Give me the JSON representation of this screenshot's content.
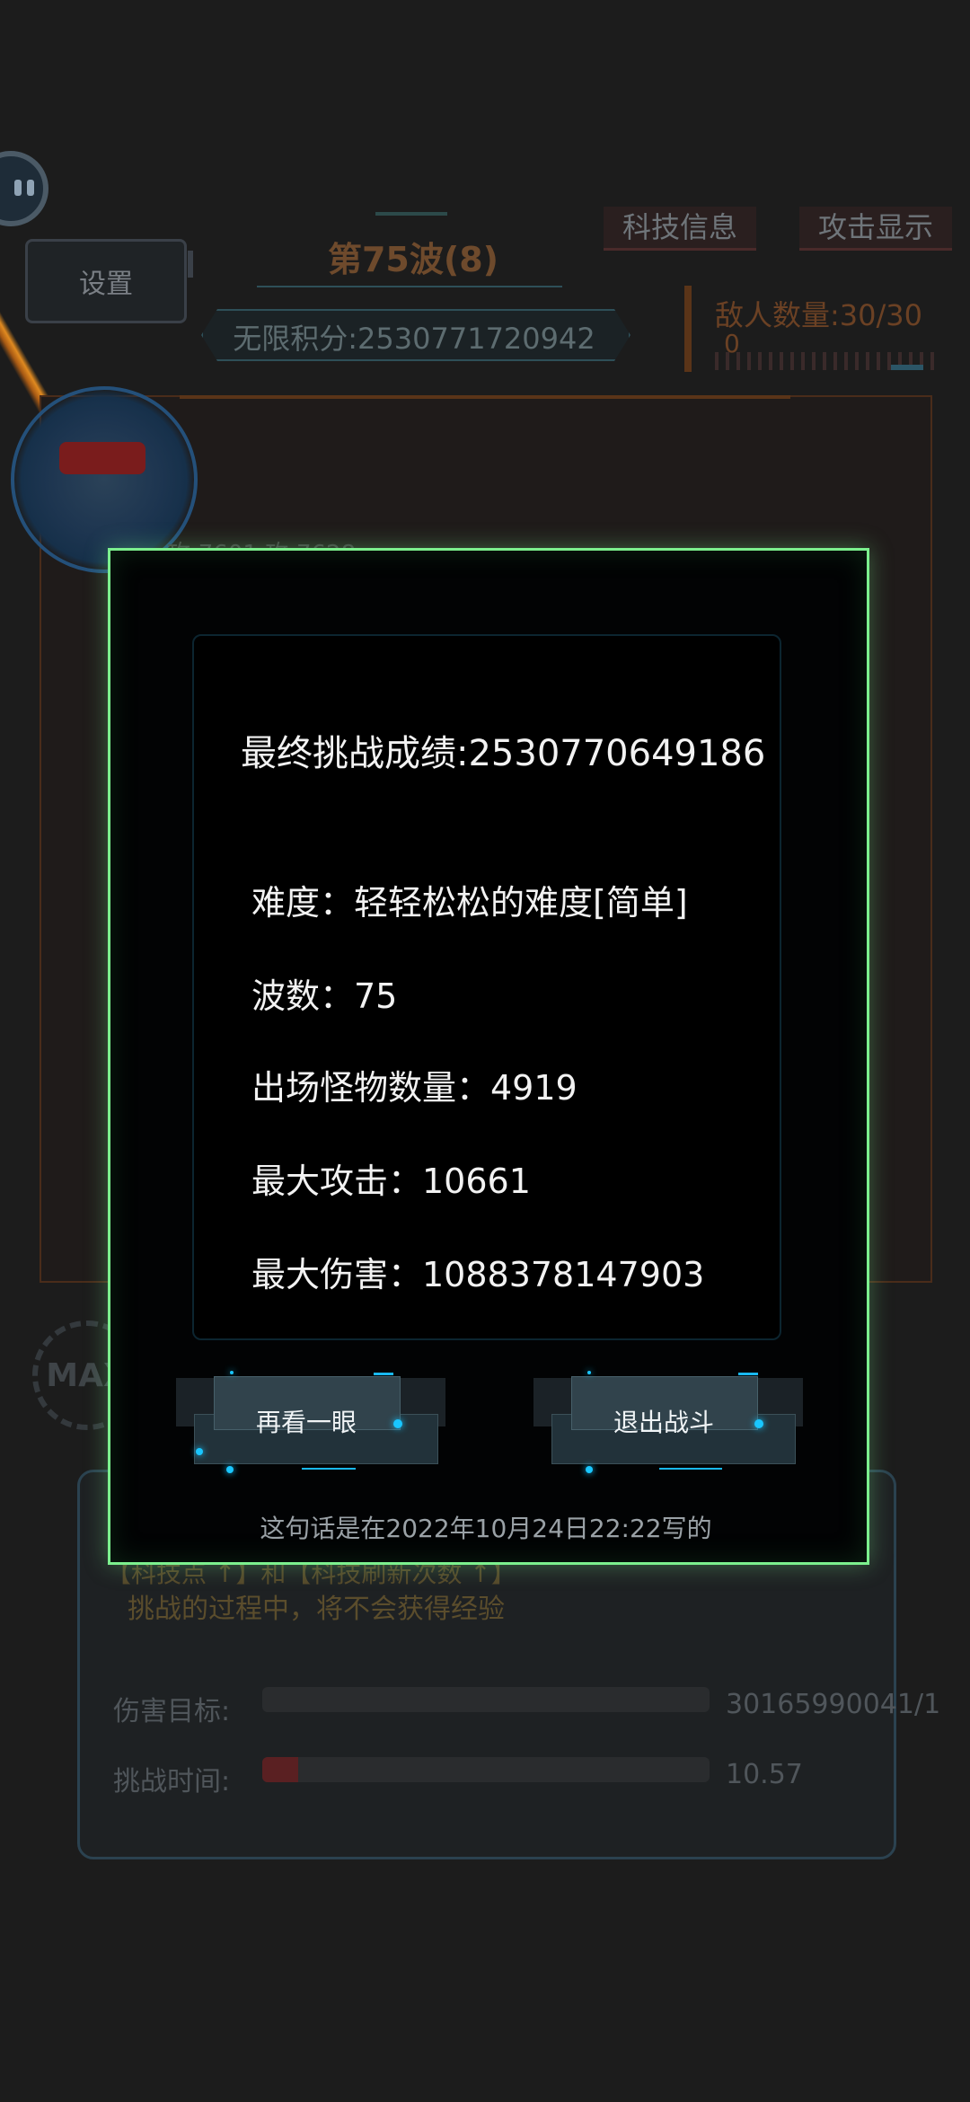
{
  "hud": {
    "settings_label": "设置",
    "wave_title": "第75波(8)",
    "infinite_score": "无限积分:2530771720942",
    "tabs": [
      "科技信息",
      "攻击显示"
    ],
    "enemy_count": "敌人数量:30/30",
    "enemy_count_sub": "0",
    "attack_hint": "攻:7601      攻:7628",
    "max_badge": "MAX",
    "enemy_color": "#6b4124",
    "accent_color": "#7cf08e"
  },
  "info_panel": {
    "line1": "【科技点  ↑】和【科技刷新次数  ↑】",
    "line2": "挑战的过程中，将不会获得经验",
    "damage_target_label": "伤害目标:",
    "damage_target_value": "30165990041/1",
    "damage_target_progress": 0,
    "challenge_time_label": "挑战时间:",
    "challenge_time_value": "10.57",
    "challenge_time_progress": 0.08
  },
  "result": {
    "final_score": "最终挑战成绩:2530770649186",
    "difficulty": "难度：轻轻松松的难度[简单]",
    "waves": "波数：75",
    "monster_count": "出场怪物数量：4919",
    "max_attack": "最大攻击：10661",
    "max_damage": "最大伤害：1088378147903",
    "review_button": "再看一眼",
    "exit_button": "退出战斗",
    "footer_note": "这句话是在2022年10月24日22:22写的"
  }
}
